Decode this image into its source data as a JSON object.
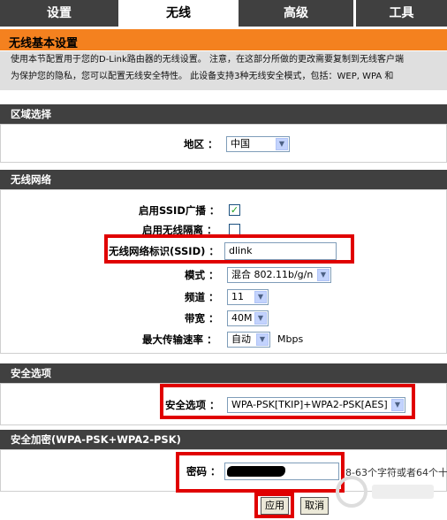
{
  "tabs": [
    "设置",
    "无线",
    "高级",
    "工具"
  ],
  "page_title": "无线基本设置",
  "intro": {
    "line1": "使用本节配置用于您的D-Link路由器的无线设置。 注意，在这部分所做的更改需要复制到无线客户端",
    "line2": "为保护您的隐私，您可以配置无线安全特性。 此设备支持3种无线安全模式，包括：WEP, WPA 和"
  },
  "region": {
    "header": "区域选择",
    "label": "地区 ：",
    "value": "中国"
  },
  "wireless": {
    "header": "无线网络",
    "ssid_broadcast_label": "启用SSID广播 ：",
    "ssid_broadcast_checked": true,
    "isolation_label": "启用无线隔离 ：",
    "isolation_checked": false,
    "ssid_label": "无线网络标识(SSID) ：",
    "ssid_value": "dlink",
    "mode_label": "模式 ：",
    "mode_value": "混合 802.11b/g/n",
    "channel_label": "频道 ：",
    "channel_value": "11",
    "bandwidth_label": "带宽 ：",
    "bandwidth_value": "40M",
    "rate_label": "最大传输速率 ：",
    "rate_value": "自动",
    "rate_unit": "Mbps"
  },
  "security": {
    "header": "安全选项",
    "label": "安全选项 ：",
    "value": "WPA-PSK[TKIP]+WPA2-PSK[AES]"
  },
  "encryption": {
    "header": "安全加密(WPA-PSK+WPA2-PSK)",
    "password_label": "密码 ：",
    "hint": "8-63个字符或者64个十"
  },
  "buttons": {
    "apply": "应用",
    "cancel": "取消"
  },
  "colors": {
    "tab_bg": "#404040",
    "title_orange": "#f4811f",
    "highlight_red": "#e00000"
  }
}
